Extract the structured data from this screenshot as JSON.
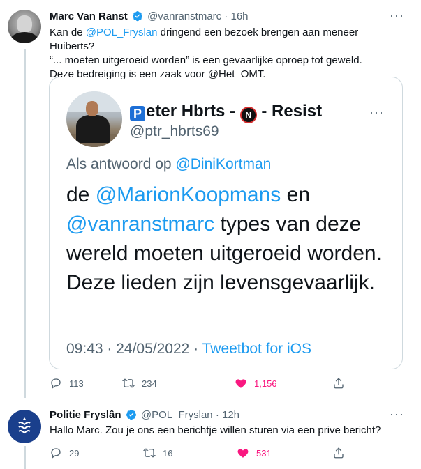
{
  "tweet1": {
    "name": "Marc Van Ranst",
    "handle": "@vanranstmarc",
    "dot": "·",
    "time": "16h",
    "text_prefix": "Kan de ",
    "mention": "@POL_Fryslan",
    "text_line1_rest": " dringend een bezoek brengen aan meneer Huiberts?",
    "text_line2": "“... moeten uitgeroeid worden” is een gevaarlijke oproep tot geweld.",
    "text_line3": "Deze bedreiging is een zaak voor @Het_OMT.",
    "more": "···",
    "replies": "113",
    "retweets": "234",
    "likes": "1,156"
  },
  "quoted": {
    "name_p": "P",
    "name_rest": "eter Hbrts - ",
    "noicon": "N",
    "name_tail": " - Resist",
    "handle": "@ptr_hbrts69",
    "more": "···",
    "reply_prefix": "Als antwoord op ",
    "reply_mention": "@DiniKortman",
    "text_de": "de ",
    "text_mention1": "@MarionKoopmans",
    "text_en": " en",
    "text_mention2": "@vanranstmarc",
    "text_rest": " types van deze wereld moeten uitgeroeid worden. Deze lieden zijn levensgevaarlijk.",
    "timestamp": "09:43 · 24/05/2022 · ",
    "source": "Tweetbot for iOS"
  },
  "tweet2": {
    "name": "Politie Fryslân",
    "handle": "@POL_Fryslan",
    "dot": "·",
    "time": "12h",
    "text": "Hallo Marc. Zou je ons een berichtje willen sturen via een prive bericht?",
    "more": "···",
    "replies": "29",
    "retweets": "16",
    "likes": "531"
  },
  "colors": {
    "link": "#1d9bf0",
    "like": "#f91880",
    "muted": "#536471",
    "verified": "#1d9bf0"
  },
  "icons": [
    "verified-badge-icon",
    "more-icon",
    "reply-icon",
    "retweet-icon",
    "heart-icon",
    "share-icon",
    "police-badge-icon",
    "no-sign-icon",
    "parking-p-icon"
  ]
}
